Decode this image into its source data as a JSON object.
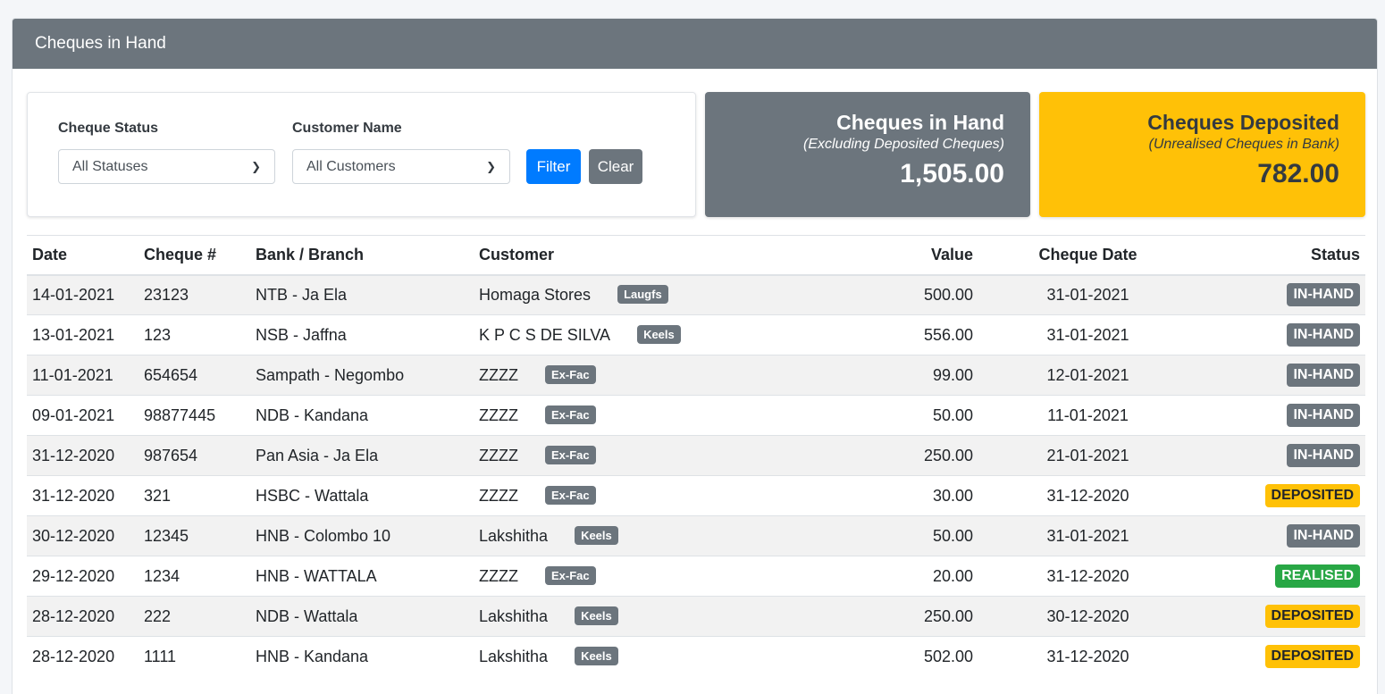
{
  "page": {
    "title": "Cheques in Hand"
  },
  "filters": {
    "status_label": "Cheque Status",
    "status_value": "All Statuses",
    "customer_label": "Customer Name",
    "customer_value": "All Customers",
    "filter_button": "Filter",
    "clear_button": "Clear"
  },
  "summary": {
    "in_hand": {
      "title": "Cheques in Hand",
      "subtitle": "(Excluding Deposited Cheques)",
      "value": "1,505.00"
    },
    "deposited": {
      "title": "Cheques Deposited",
      "subtitle": "(Unrealised Cheques in Bank)",
      "value": "782.00"
    }
  },
  "table": {
    "columns": [
      "Date",
      "Cheque #",
      "Bank / Branch",
      "Customer",
      "Value",
      "Cheque Date",
      "Status"
    ],
    "rows": [
      {
        "date": "14-01-2021",
        "cheque_no": "23123",
        "bank": "NTB - Ja Ela",
        "customer": "Homaga Stores",
        "tag": "Laugfs",
        "value": "500.00",
        "cheque_date": "31-01-2021",
        "status": "IN-HAND"
      },
      {
        "date": "13-01-2021",
        "cheque_no": "123",
        "bank": "NSB - Jaffna",
        "customer": "K P C S DE SILVA",
        "tag": "Keels",
        "value": "556.00",
        "cheque_date": "31-01-2021",
        "status": "IN-HAND"
      },
      {
        "date": "11-01-2021",
        "cheque_no": "654654",
        "bank": "Sampath - Negombo",
        "customer": "ZZZZ",
        "tag": "Ex-Fac",
        "value": "99.00",
        "cheque_date": "12-01-2021",
        "status": "IN-HAND"
      },
      {
        "date": "09-01-2021",
        "cheque_no": "98877445",
        "bank": "NDB - Kandana",
        "customer": "ZZZZ",
        "tag": "Ex-Fac",
        "value": "50.00",
        "cheque_date": "11-01-2021",
        "status": "IN-HAND"
      },
      {
        "date": "31-12-2020",
        "cheque_no": "987654",
        "bank": "Pan Asia - Ja Ela",
        "customer": "ZZZZ",
        "tag": "Ex-Fac",
        "value": "250.00",
        "cheque_date": "21-01-2021",
        "status": "IN-HAND"
      },
      {
        "date": "31-12-2020",
        "cheque_no": "321",
        "bank": "HSBC - Wattala",
        "customer": "ZZZZ",
        "tag": "Ex-Fac",
        "value": "30.00",
        "cheque_date": "31-12-2020",
        "status": "DEPOSITED"
      },
      {
        "date": "30-12-2020",
        "cheque_no": "12345",
        "bank": "HNB - Colombo 10",
        "customer": "Lakshitha",
        "tag": "Keels",
        "value": "50.00",
        "cheque_date": "31-01-2021",
        "status": "IN-HAND"
      },
      {
        "date": "29-12-2020",
        "cheque_no": "1234",
        "bank": "HNB - WATTALA",
        "customer": "ZZZZ",
        "tag": "Ex-Fac",
        "value": "20.00",
        "cheque_date": "31-12-2020",
        "status": "REALISED"
      },
      {
        "date": "28-12-2020",
        "cheque_no": "222",
        "bank": "NDB - Wattala",
        "customer": "Lakshitha",
        "tag": "Keels",
        "value": "250.00",
        "cheque_date": "30-12-2020",
        "status": "DEPOSITED"
      },
      {
        "date": "28-12-2020",
        "cheque_no": "1111",
        "bank": "HNB - Kandana",
        "customer": "Lakshitha",
        "tag": "Keels",
        "value": "502.00",
        "cheque_date": "31-12-2020",
        "status": "DEPOSITED"
      }
    ]
  },
  "colors": {
    "header_bg": "#6c757d",
    "in_hand": "#6c757d",
    "deposited": "#ffc107",
    "realised": "#28a745",
    "primary": "#007bff"
  }
}
